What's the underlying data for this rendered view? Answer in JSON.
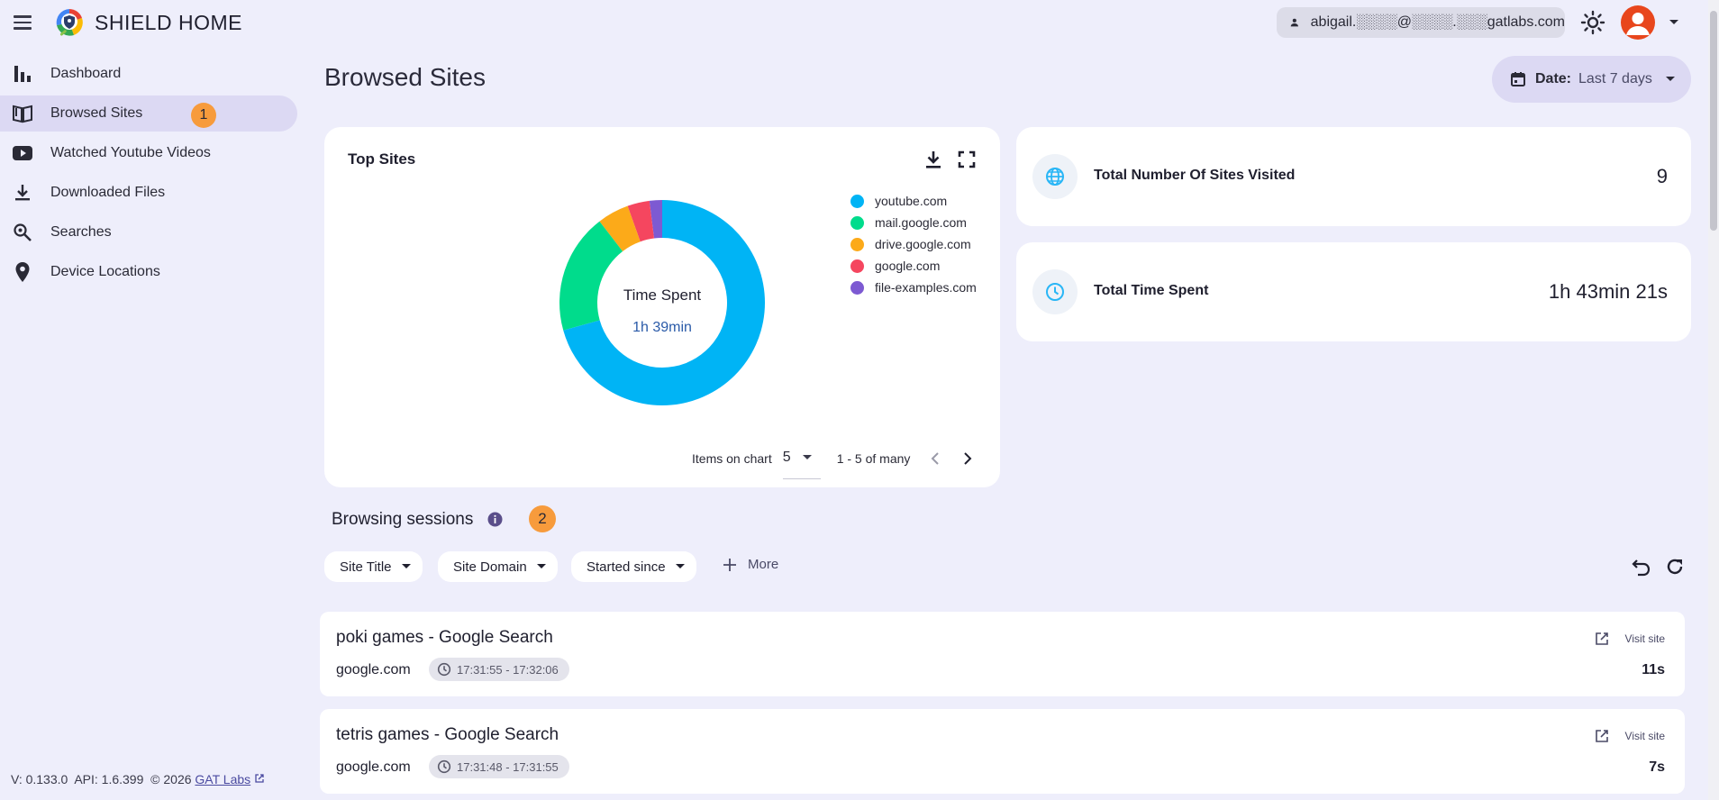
{
  "app": {
    "title": "SHIELD HOME"
  },
  "header": {
    "user_email": "abigail.░░░░@░░░░.░░░gatlabs.com"
  },
  "sidebar": {
    "items": [
      {
        "label": "Dashboard",
        "icon": "bar-chart-icon"
      },
      {
        "label": "Browsed Sites",
        "icon": "book-icon",
        "active": true,
        "badge": "1"
      },
      {
        "label": "Watched Youtube Videos",
        "icon": "youtube-icon"
      },
      {
        "label": "Downloaded Files",
        "icon": "download-icon"
      },
      {
        "label": "Searches",
        "icon": "search-icon"
      },
      {
        "label": "Device Locations",
        "icon": "location-pin-icon"
      }
    ],
    "footer": {
      "version": "V: 0.133.0",
      "api": "API: 1.6.399",
      "copyright": "© 2026",
      "link": "GAT Labs"
    }
  },
  "main": {
    "page_title": "Browsed Sites",
    "date_filter": {
      "label": "Date:",
      "value": "Last 7 days"
    },
    "top_sites": {
      "title": "Top Sites",
      "center_label": "Time Spent",
      "center_value": "1h 39min",
      "items_on_chart_label": "Items on chart",
      "items_on_chart_value": "5",
      "range_text": "1 - 5 of many"
    },
    "stats": {
      "sites_label": "Total Number Of Sites Visited",
      "sites_value": "9",
      "time_label": "Total Time Spent",
      "time_value": "1h 43min 21s"
    },
    "sessions": {
      "title": "Browsing sessions",
      "badge": "2",
      "filters": [
        "Site Title",
        "Site Domain",
        "Started since"
      ],
      "more_label": "More",
      "visit_label": "Visit site",
      "rows": [
        {
          "title": "poki games - Google Search",
          "domain": "google.com",
          "time": "17:31:55 - 17:32:06",
          "duration": "11s"
        },
        {
          "title": "tetris games - Google Search",
          "domain": "google.com",
          "time": "17:31:48 - 17:31:55",
          "duration": "7s"
        }
      ]
    }
  },
  "colors": {
    "accent": "#dcd9f3",
    "badge": "#f79b3c",
    "avatar": "#e8461c",
    "icon_blue": "#29b6f6"
  },
  "chart_data": {
    "type": "pie",
    "categories": [
      "youtube.com",
      "mail.google.com",
      "drive.google.com",
      "google.com",
      "file-examples.com"
    ],
    "values": [
      71,
      19,
      5,
      3.5,
      2
    ],
    "colors": [
      "#00b4f5",
      "#00dc8c",
      "#fcaa19",
      "#f5465f",
      "#7d5ad2"
    ],
    "title": "Top Sites",
    "legend": "right"
  }
}
